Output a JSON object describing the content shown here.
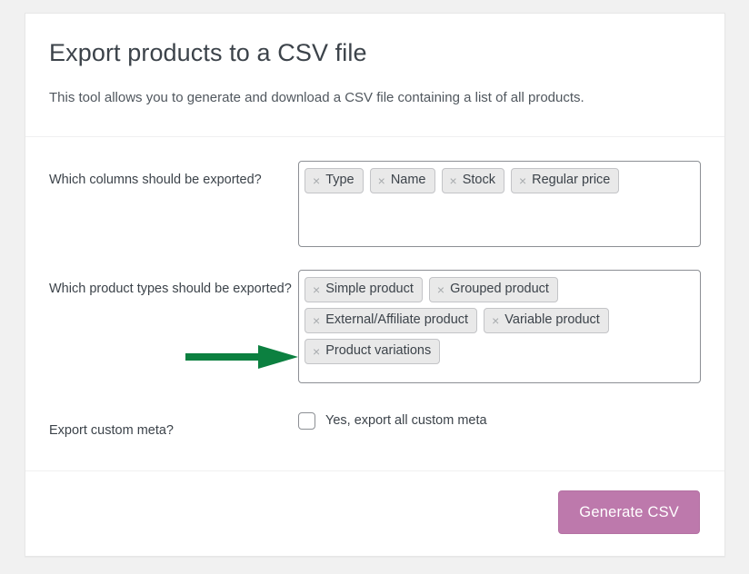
{
  "header": {
    "title": "Export products to a CSV file",
    "description": "This tool allows you to generate and download a CSV file containing a list of all products."
  },
  "form": {
    "columns": {
      "label": "Which columns should be exported?",
      "chips": [
        {
          "remove": "×",
          "label": "Type"
        },
        {
          "remove": "×",
          "label": "Name"
        },
        {
          "remove": "×",
          "label": "Stock"
        },
        {
          "remove": "×",
          "label": "Regular price"
        }
      ]
    },
    "product_types": {
      "label": "Which product types should be exported?",
      "chips": [
        {
          "remove": "×",
          "label": "Simple product"
        },
        {
          "remove": "×",
          "label": "Grouped product"
        },
        {
          "remove": "×",
          "label": "External/Affiliate product"
        },
        {
          "remove": "×",
          "label": "Variable product"
        },
        {
          "remove": "×",
          "label": "Product variations"
        }
      ]
    },
    "custom_meta": {
      "label": "Export custom meta?",
      "checkbox_label": "Yes, export all custom meta",
      "checked": false
    }
  },
  "footer": {
    "submit_label": "Generate CSV"
  },
  "annotation": {
    "type": "arrow",
    "direction": "right",
    "color": "#0c8040",
    "points_to": "Product variations"
  },
  "colors": {
    "page_background": "#f1f1f1",
    "card_background": "#ffffff",
    "title_text": "#3c434a",
    "body_text": "#50575e",
    "field_border": "#8c8f94",
    "chip_background": "#e9e9e9",
    "chip_border": "#c3c4c7",
    "button_background": "#bd79ac",
    "annotation_green": "#0c8040"
  }
}
